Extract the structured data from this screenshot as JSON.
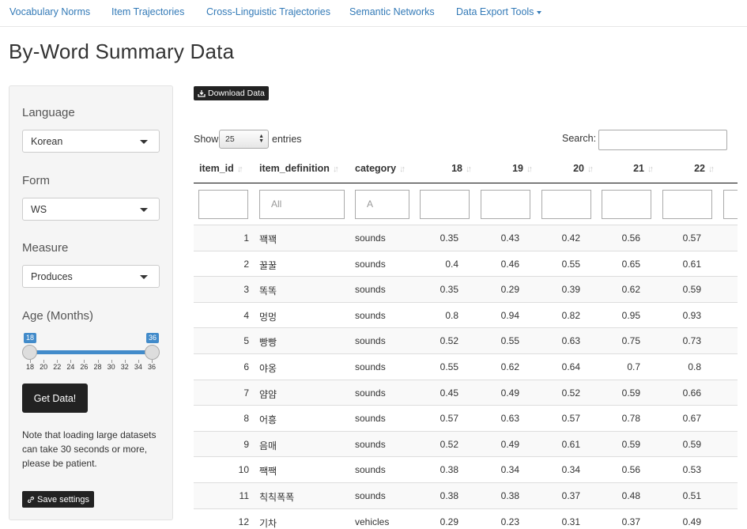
{
  "nav": {
    "items": [
      "Vocabulary Norms",
      "Item Trajectories",
      "Cross-Linguistic Trajectories",
      "Semantic Networks",
      "Data Export Tools"
    ]
  },
  "page_title": "By-Word Summary Data",
  "sidebar": {
    "language_label": "Language",
    "language_value": "Korean",
    "form_label": "Form",
    "form_value": "WS",
    "measure_label": "Measure",
    "measure_value": "Produces",
    "age_label": "Age (Months)",
    "age_min": "18",
    "age_max": "36",
    "age_ticks": [
      "18",
      "20",
      "22",
      "24",
      "26",
      "28",
      "30",
      "32",
      "34",
      "36"
    ],
    "get_data_label": "Get Data!",
    "note": "Note that loading large datasets can take 30 seconds or more, please be patient.",
    "save_label": "Save settings"
  },
  "main": {
    "download_label": "Download Data",
    "show_label": "Show",
    "entries_value": "25",
    "entries_label": "entries",
    "search_label": "Search:"
  },
  "table": {
    "headers": [
      "item_id",
      "item_definition",
      "category",
      "18",
      "19",
      "20",
      "21",
      "22"
    ],
    "filter_placeholders": [
      "",
      "All",
      "A",
      "",
      "",
      "",
      "",
      ""
    ],
    "rows": [
      [
        "1",
        "꽥꽥",
        "sounds",
        "0.35",
        "0.43",
        "0.42",
        "0.56",
        "0.57"
      ],
      [
        "2",
        "꿀꿀",
        "sounds",
        "0.4",
        "0.46",
        "0.55",
        "0.65",
        "0.61"
      ],
      [
        "3",
        "똑똑",
        "sounds",
        "0.35",
        "0.29",
        "0.39",
        "0.62",
        "0.59"
      ],
      [
        "4",
        "멍멍",
        "sounds",
        "0.8",
        "0.94",
        "0.82",
        "0.95",
        "0.93"
      ],
      [
        "5",
        "빵빵",
        "sounds",
        "0.52",
        "0.55",
        "0.63",
        "0.75",
        "0.73"
      ],
      [
        "6",
        "야옹",
        "sounds",
        "0.55",
        "0.62",
        "0.64",
        "0.7",
        "0.8"
      ],
      [
        "7",
        "얌얌",
        "sounds",
        "0.45",
        "0.49",
        "0.52",
        "0.59",
        "0.66"
      ],
      [
        "8",
        "어흥",
        "sounds",
        "0.57",
        "0.63",
        "0.57",
        "0.78",
        "0.67"
      ],
      [
        "9",
        "음매",
        "sounds",
        "0.52",
        "0.49",
        "0.61",
        "0.59",
        "0.59"
      ],
      [
        "10",
        "짹짹",
        "sounds",
        "0.38",
        "0.34",
        "0.34",
        "0.56",
        "0.53"
      ],
      [
        "11",
        "칙칙폭폭",
        "sounds",
        "0.38",
        "0.38",
        "0.37",
        "0.48",
        "0.51"
      ],
      [
        "12",
        "기차",
        "vehicles",
        "0.29",
        "0.23",
        "0.31",
        "0.37",
        "0.49"
      ]
    ]
  },
  "colors": {
    "link": "#337ab7",
    "slider": "#428bca",
    "button": "#222222"
  }
}
